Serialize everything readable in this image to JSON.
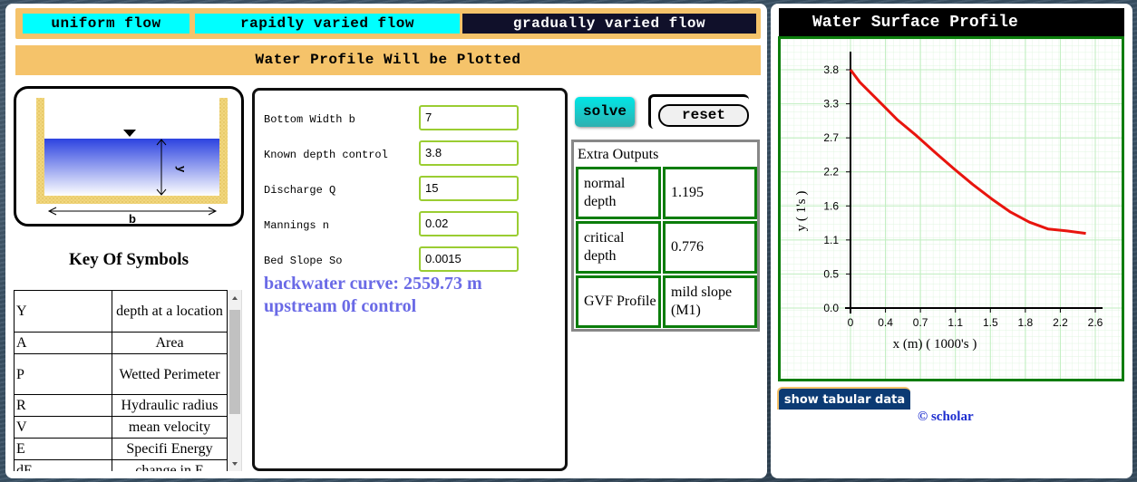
{
  "tabs": [
    {
      "label": "uniform flow",
      "active": false
    },
    {
      "label": "rapidly varied flow",
      "active": false
    },
    {
      "label": "gradually varied flow",
      "active": true
    }
  ],
  "banner": "Water Profile Will be Plotted",
  "diagram": {
    "depth_label": "y",
    "width_label": "b"
  },
  "key": {
    "title": "Key Of Symbols",
    "rows": [
      {
        "symbol": "Y",
        "description": "depth at a location"
      },
      {
        "symbol": "A",
        "description": "Area"
      },
      {
        "symbol": "P",
        "description": "Wetted Perimeter"
      },
      {
        "symbol": "R",
        "description": "Hydraulic radius"
      },
      {
        "symbol": "V",
        "description": "mean velocity"
      },
      {
        "symbol": "E",
        "description": "Specifi Energy"
      },
      {
        "symbol": "dE",
        "description": "change in E"
      }
    ]
  },
  "inputs": [
    {
      "label": "Bottom Width b",
      "value": "7"
    },
    {
      "label": "Known depth control",
      "value": "3.8"
    },
    {
      "label": "Discharge Q",
      "value": "15"
    },
    {
      "label": "Mannings n",
      "value": "0.02"
    },
    {
      "label": "Bed Slope So",
      "value": "0.0015"
    }
  ],
  "result": "backwater curve: 2559.73 m upstream 0f control",
  "buttons": {
    "solve": "solve",
    "reset": "reset",
    "tabular": "show tabular data"
  },
  "extra": {
    "title": "Extra Outputs",
    "rows": [
      {
        "label": "normal depth",
        "value": "1.195"
      },
      {
        "label": "critical depth",
        "value": "0.776"
      },
      {
        "label": "GVF Profile",
        "value": "mild slope (M1)"
      }
    ]
  },
  "footer": "© scholar",
  "colors": {
    "curve": "#e8150e",
    "grid": "#bfeebf",
    "border": "#0b7d0b",
    "accent": "#f5c36a"
  },
  "chart_data": {
    "type": "line",
    "title": "Water Surface Profile",
    "xlabel": "x (m) ( 1000's )",
    "ylabel": "y ( 1's )",
    "xlim": [
      0,
      2.6
    ],
    "ylim": [
      0,
      3.8
    ],
    "x_ticks": [
      "0",
      "0.4",
      "0.7",
      "1.1",
      "1.5",
      "1.8",
      "2.2",
      "2.6"
    ],
    "y_ticks": [
      "0.0",
      "0.5",
      "1.1",
      "1.6",
      "2.2",
      "2.7",
      "3.3",
      "3.8"
    ],
    "grid": true,
    "series": [
      {
        "x": [
          0,
          0.1,
          0.3,
          0.5,
          0.7,
          0.9,
          1.1,
          1.3,
          1.5,
          1.7,
          1.9,
          2.1,
          2.3,
          2.5
        ],
        "y": [
          3.8,
          3.6,
          3.3,
          3.0,
          2.75,
          2.48,
          2.22,
          1.97,
          1.74,
          1.53,
          1.37,
          1.26,
          1.23,
          1.19
        ]
      }
    ]
  }
}
